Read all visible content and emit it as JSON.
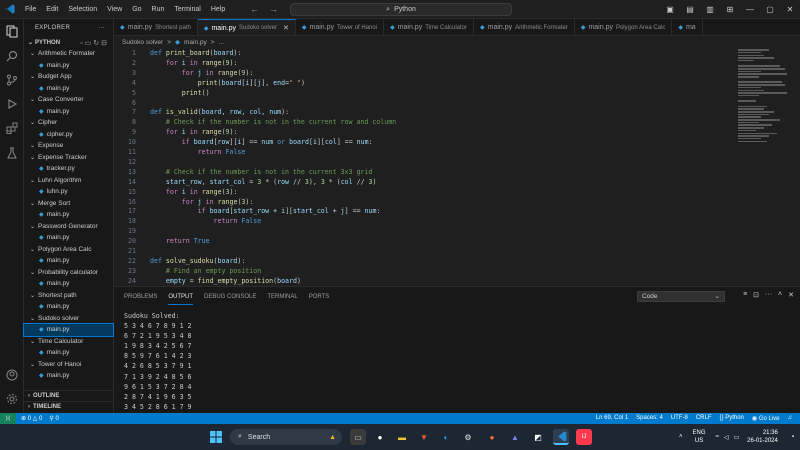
{
  "titlebar": {
    "menu": [
      "File",
      "Edit",
      "Selection",
      "View",
      "Go",
      "Run",
      "Terminal",
      "Help"
    ],
    "search_text": "Python"
  },
  "sidebar": {
    "header": "EXPLORER",
    "project": "PYTHON",
    "items": [
      {
        "type": "folder",
        "label": "Arithmetic Formater"
      },
      {
        "type": "file",
        "label": "main.py"
      },
      {
        "type": "folder",
        "label": "Budget App"
      },
      {
        "type": "file",
        "label": "main.py"
      },
      {
        "type": "folder",
        "label": "Case Converter"
      },
      {
        "type": "file",
        "label": "main.py"
      },
      {
        "type": "folder",
        "label": "Cipher"
      },
      {
        "type": "file",
        "label": "cipher.py"
      },
      {
        "type": "folder",
        "label": "Expense"
      },
      {
        "type": "folder",
        "label": "Expense Tracker"
      },
      {
        "type": "file",
        "label": "tracker.py"
      },
      {
        "type": "folder",
        "label": "Luhn Algorithm"
      },
      {
        "type": "file",
        "label": "luhn.py"
      },
      {
        "type": "folder",
        "label": "Merge Sort"
      },
      {
        "type": "file",
        "label": "main.py"
      },
      {
        "type": "folder",
        "label": "Password Generator"
      },
      {
        "type": "file",
        "label": "main.py"
      },
      {
        "type": "folder",
        "label": "Polygon Area Calc"
      },
      {
        "type": "file",
        "label": "main.py"
      },
      {
        "type": "folder",
        "label": "Probability calculator"
      },
      {
        "type": "file",
        "label": "main.py"
      },
      {
        "type": "folder",
        "label": "Shortest path"
      },
      {
        "type": "file",
        "label": "main.py"
      },
      {
        "type": "folder",
        "label": "Sudoko solver"
      },
      {
        "type": "file",
        "label": "main.py",
        "selected": true
      },
      {
        "type": "folder",
        "label": "Time Calculator"
      },
      {
        "type": "file",
        "label": "main.py"
      },
      {
        "type": "folder",
        "label": "Tower of Hanoi"
      },
      {
        "type": "file",
        "label": "main.py"
      }
    ],
    "outline": "OUTLINE",
    "timeline": "TIMELINE"
  },
  "tabs": [
    {
      "name": "main.py",
      "desc": "Shortest path",
      "active": false
    },
    {
      "name": "main.py",
      "desc": "Sudoko solver",
      "active": true
    },
    {
      "name": "main.py",
      "desc": "Tower of Hanoi",
      "active": false
    },
    {
      "name": "main.py",
      "desc": "Time Calculator",
      "active": false
    },
    {
      "name": "main.py",
      "desc": "Arithmetic Formater",
      "active": false
    },
    {
      "name": "main.py",
      "desc": "Polygon Area Calc",
      "active": false
    },
    {
      "name": "ma",
      "desc": "",
      "active": false
    }
  ],
  "breadcrumb": [
    "Sudoko solver",
    ">",
    "main.py",
    ">",
    "..."
  ],
  "editor": {
    "lines": [
      {
        "n": "1",
        "html": "<span class='kw'>def</span> <span class='fn'>print_board</span>(<span class='var'>board</span>):"
      },
      {
        "n": "2",
        "html": "    <span class='ctl'>for</span> <span class='var'>i</span> <span class='ctl'>in</span> <span class='bi'>range</span>(<span class='num'>9</span>):"
      },
      {
        "n": "3",
        "html": "        <span class='ctl'>for</span> <span class='var'>j</span> <span class='ctl'>in</span> <span class='bi'>range</span>(<span class='num'>9</span>):"
      },
      {
        "n": "4",
        "html": "            <span class='bi'>print</span>(<span class='var'>board</span>[<span class='var'>i</span>][<span class='var'>j</span>], <span class='var'>end</span>=<span class='str'>\" \"</span>)"
      },
      {
        "n": "5",
        "html": "        <span class='bi'>print</span>()"
      },
      {
        "n": "6",
        "html": ""
      },
      {
        "n": "7",
        "html": "<span class='kw'>def</span> <span class='fn'>is_valid</span>(<span class='var'>board</span>, <span class='var'>row</span>, <span class='var'>col</span>, <span class='var'>num</span>):"
      },
      {
        "n": "8",
        "html": "    <span class='cm'># Check if the number is not in the current row and column</span>"
      },
      {
        "n": "9",
        "html": "    <span class='ctl'>for</span> <span class='var'>i</span> <span class='ctl'>in</span> <span class='bi'>range</span>(<span class='num'>9</span>):"
      },
      {
        "n": "10",
        "html": "        <span class='ctl'>if</span> <span class='var'>board</span>[<span class='var'>row</span>][<span class='var'>i</span>] == <span class='var'>num</span> <span class='kw'>or</span> <span class='var'>board</span>[<span class='var'>i</span>][<span class='var'>col</span>] == <span class='var'>num</span>:"
      },
      {
        "n": "11",
        "html": "            <span class='ctl'>return</span> <span class='kw'>False</span>"
      },
      {
        "n": "12",
        "html": ""
      },
      {
        "n": "13",
        "html": "    <span class='cm'># Check if the number is not in the current 3x3 grid</span>"
      },
      {
        "n": "14",
        "html": "    <span class='var'>start_row</span>, <span class='var'>start_col</span> = <span class='num'>3</span> * (<span class='var'>row</span> // <span class='num'>3</span>), <span class='num'>3</span> * (<span class='var'>col</span> // <span class='num'>3</span>)"
      },
      {
        "n": "15",
        "html": "    <span class='ctl'>for</span> <span class='var'>i</span> <span class='ctl'>in</span> <span class='bi'>range</span>(<span class='num'>3</span>):"
      },
      {
        "n": "16",
        "html": "        <span class='ctl'>for</span> <span class='var'>j</span> <span class='ctl'>in</span> <span class='bi'>range</span>(<span class='num'>3</span>):"
      },
      {
        "n": "17",
        "html": "            <span class='ctl'>if</span> <span class='var'>board</span>[<span class='var'>start_row</span> + <span class='var'>i</span>][<span class='var'>start_col</span> + <span class='var'>j</span>] == <span class='var'>num</span>:"
      },
      {
        "n": "18",
        "html": "                <span class='ctl'>return</span> <span class='kw'>False</span>"
      },
      {
        "n": "19",
        "html": ""
      },
      {
        "n": "20",
        "html": "    <span class='ctl'>return</span> <span class='kw'>True</span>"
      },
      {
        "n": "21",
        "html": ""
      },
      {
        "n": "22",
        "html": "<span class='kw'>def</span> <span class='fn'>solve_sudoku</span>(<span class='var'>board</span>):"
      },
      {
        "n": "23",
        "html": "    <span class='cm'># Find an empty position</span>"
      },
      {
        "n": "24",
        "html": "    <span class='var'>empty</span> = <span class='fn'>find_empty_position</span>(<span class='var'>board</span>)"
      }
    ]
  },
  "panel": {
    "tabs": [
      "PROBLEMS",
      "OUTPUT",
      "DEBUG CONSOLE",
      "TERMINAL",
      "PORTS"
    ],
    "active_tab": "OUTPUT",
    "channel": "Code",
    "output_lines": [
      "Sudoku Solved:",
      "5 3 4 6 7 8 9 1 2",
      "6 7 2 1 9 5 3 4 8",
      "1 9 8 3 4 2 5 6 7",
      "8 5 9 7 6 1 4 2 3",
      "4 2 6 8 5 3 7 9 1",
      "7 1 3 9 2 4 8 5 6",
      "9 6 1 5 3 7 2 8 4",
      "2 8 7 4 1 9 6 3 5",
      "3 4 5 2 8 6 1 7 9"
    ]
  },
  "statusbar": {
    "errors": "0",
    "warnings": "0",
    "ports": "0",
    "position": "Ln 69, Col 1",
    "spaces": "Spaces: 4",
    "encoding": "UTF-8",
    "eol": "CRLF",
    "language": "Python",
    "golive": "Go Live"
  },
  "taskbar": {
    "search_label": "Search",
    "lang1": "ENG",
    "lang2": "US",
    "time": "21:36",
    "date": "26-01-2024"
  },
  "colors": {
    "accent": "#0078d4",
    "statusbar": "#007acc",
    "editor_bg": "#1f1f1f"
  }
}
